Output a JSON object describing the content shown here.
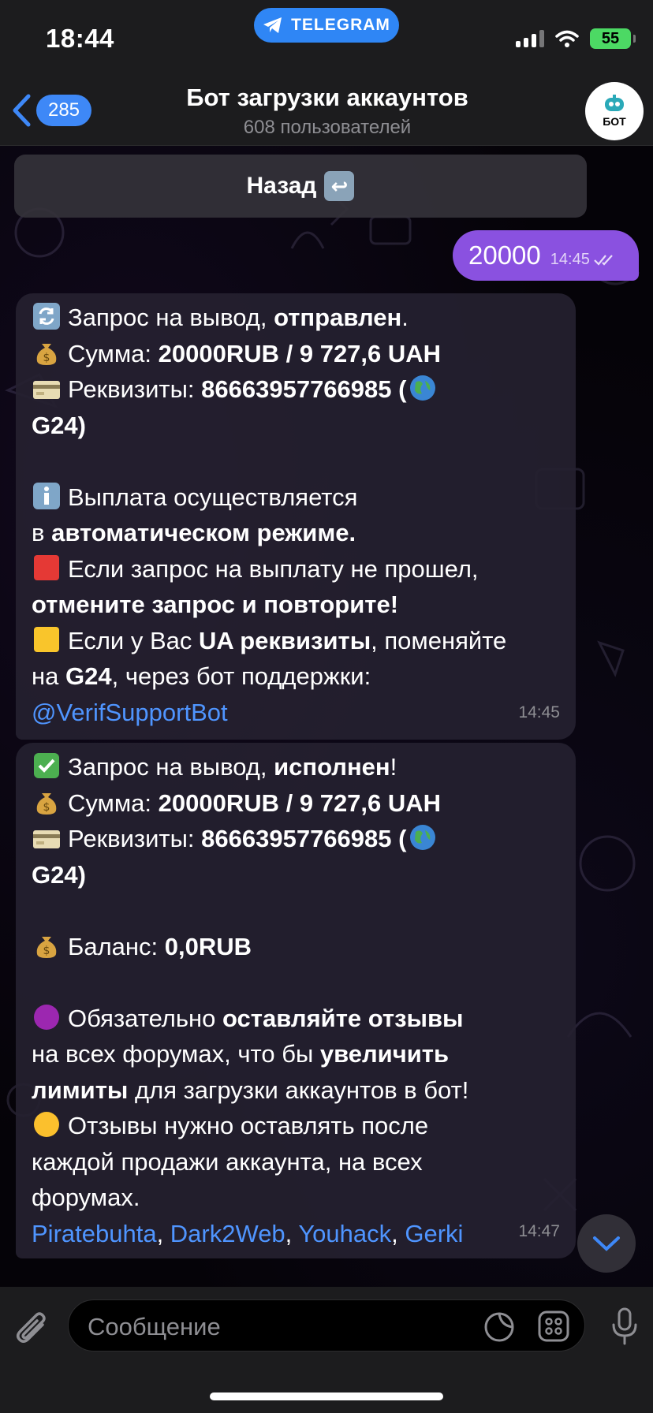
{
  "status_bar": {
    "time": "18:44",
    "app_pill": "TELEGRAM",
    "battery": "55"
  },
  "header": {
    "back_count": "285",
    "title": "Бот загрузки аккаунтов",
    "subtitle": "608 пользователей",
    "avatar_label": "БОТ"
  },
  "keyboard_button": {
    "label": "Назад"
  },
  "outgoing": {
    "text": "20000",
    "time": "14:45"
  },
  "msg1": {
    "l1a": "Запрос на вывод, ",
    "l1b": "отправлен",
    "l1c": ".",
    "l2a": "Сумма: ",
    "l2b": "20000RUB  / 9 727,6 UAH",
    "l3a": "Реквизиты: ",
    "l3b": "86663957766985 (",
    "l4": "G24)",
    "l5": "Выплата осуществляется",
    "l6a": "в ",
    "l6b": "автоматическом режиме.",
    "l7": "Если запрос на выплату не прошел,",
    "l8": "отмените запрос и повторите!",
    "l9a": "Если у Вас ",
    "l9b": "UA реквизиты",
    "l9c": ", поменяйте",
    "l10a": "на ",
    "l10b": "G24",
    "l10c": ", через бот поддержки:",
    "link": "@VerifSupportBot",
    "time": "14:45"
  },
  "msg2": {
    "l1a": "Запрос на вывод, ",
    "l1b": "исполнен",
    "l1c": "!",
    "l2a": "Сумма: ",
    "l2b": "20000RUB  / 9 727,6 UAH",
    "l3a": "Реквизиты: ",
    "l3b": "86663957766985 (",
    "l4": "G24)",
    "l5a": "Баланс: ",
    "l5b": "0,0RUB",
    "l6a": "Обязательно ",
    "l6b": "оставляйте отзывы",
    "l7a": "на всех форумах, что бы ",
    "l7b": "увеличить",
    "l8a": "лимиты",
    "l8b": " для загрузки аккаунтов в бот!",
    "l9": "Отзывы нужно оставлять после",
    "l10": "каждой продажи аккаунта, на всех",
    "l11": "форумах.",
    "links": [
      "Piratebuhta",
      "Dark2Web",
      "Youhack",
      "Gerki"
    ],
    "sep": ", ",
    "time": "14:47"
  },
  "input": {
    "placeholder": "Сообщение"
  },
  "colors": {
    "accent": "#3e88f7",
    "outgoing_bubble": "#8a51e0",
    "link": "#4f95ff",
    "battery": "#4cd964"
  }
}
